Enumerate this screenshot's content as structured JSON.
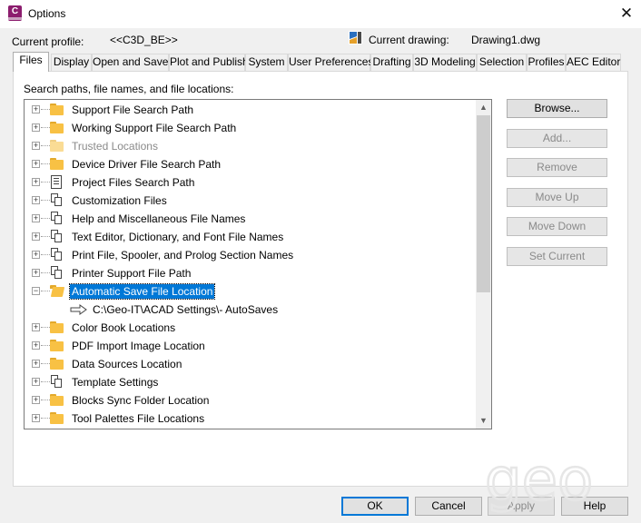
{
  "window": {
    "title": "Options",
    "app_icon_letter": "C",
    "close_glyph": "✕"
  },
  "profile": {
    "current_profile_label": "Current profile:",
    "current_profile_value": "<<C3D_BE>>",
    "current_drawing_label": "Current drawing:",
    "current_drawing_value": "Drawing1.dwg"
  },
  "tabs": [
    {
      "label": "Files",
      "active": true
    },
    {
      "label": "Display"
    },
    {
      "label": "Open and Save"
    },
    {
      "label": "Plot and Publish"
    },
    {
      "label": "System"
    },
    {
      "label": "User Preferences"
    },
    {
      "label": "Drafting"
    },
    {
      "label": "3D Modeling"
    },
    {
      "label": "Selection"
    },
    {
      "label": "Profiles"
    },
    {
      "label": "AEC Editor"
    }
  ],
  "files_tab": {
    "section_label": "Search paths, file names, and file locations:",
    "tree": [
      {
        "label": "Support File Search Path",
        "icon": "folder-icon"
      },
      {
        "label": "Working Support File Search Path",
        "icon": "folder-icon"
      },
      {
        "label": "Trusted Locations",
        "icon": "folder-icon",
        "dimmed": true
      },
      {
        "label": "Device Driver File Search Path",
        "icon": "folder-icon"
      },
      {
        "label": "Project Files Search Path",
        "icon": "project-files-icon"
      },
      {
        "label": "Customization Files",
        "icon": "files-icon"
      },
      {
        "label": "Help and Miscellaneous File Names",
        "icon": "files-icon"
      },
      {
        "label": "Text Editor, Dictionary, and Font File Names",
        "icon": "files-icon"
      },
      {
        "label": "Print File, Spooler, and Prolog Section Names",
        "icon": "files-icon"
      },
      {
        "label": "Printer Support File Path",
        "icon": "files-icon"
      },
      {
        "label": "Automatic Save File Location",
        "icon": "open-folder-icon",
        "expanded": true,
        "selected": true,
        "child": "C:\\Geo-IT\\ACAD Settings\\- AutoSaves"
      },
      {
        "label": "Color Book Locations",
        "icon": "folder-icon"
      },
      {
        "label": "PDF Import Image Location",
        "icon": "folder-icon"
      },
      {
        "label": "Data Sources Location",
        "icon": "folder-icon"
      },
      {
        "label": "Template Settings",
        "icon": "files-icon"
      },
      {
        "label": "Blocks Sync Folder Location",
        "icon": "folder-icon"
      },
      {
        "label": "Tool Palettes File Locations",
        "icon": "folder-icon"
      }
    ],
    "side_buttons": {
      "browse": "Browse...",
      "add": "Add...",
      "remove": "Remove",
      "move_up": "Move Up",
      "move_down": "Move Down",
      "set_current": "Set Current"
    }
  },
  "footer": {
    "ok": "OK",
    "cancel": "Cancel",
    "apply": "Apply",
    "help": "Help"
  },
  "watermark": "geo"
}
